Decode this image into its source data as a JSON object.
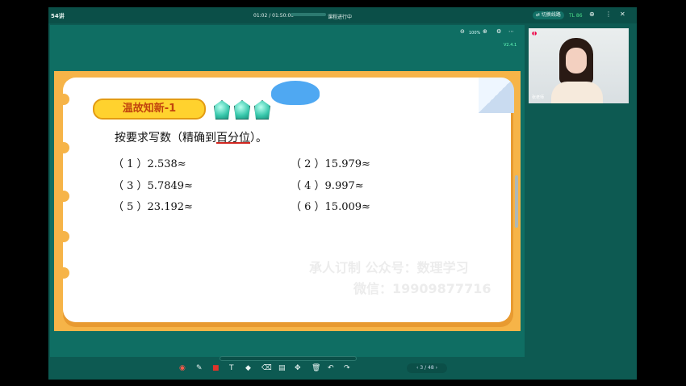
{
  "topbar": {
    "lesson_title": "54讲",
    "time": "01:02 / 01:50:00",
    "status": "课程进行中",
    "switch_label": "⇄ 切换线路",
    "signal": "TL 86",
    "icons": [
      "search-plus-icon",
      "more-icon",
      "close-icon"
    ]
  },
  "stage": {
    "zoom": "100%",
    "version": "V2.4.1"
  },
  "slide": {
    "badge": "温故知新-1",
    "task_prefix": "按要求写数（精确到",
    "task_emph": "百分位",
    "task_suffix": "）。",
    "questions": [
      {
        "label": "（ 1 ）2.538≈"
      },
      {
        "label": "（ 2 ）15.979≈"
      },
      {
        "label": "（ 3 ）5.7849≈"
      },
      {
        "label": "（ 4 ）9.997≈"
      },
      {
        "label": "（ 5 ）23.192≈"
      },
      {
        "label": "（ 6 ）15.009≈"
      }
    ],
    "watermark_1": "承人订制 公众号：数理学习",
    "watermark_2": "微信：19909877716"
  },
  "pager": {
    "text": "3 / 48"
  },
  "video": {
    "name": "张老师"
  },
  "colors": {
    "app_bg": "#0d5a52",
    "slide_frame": "#f6b448",
    "badge": "#ffd22e"
  }
}
